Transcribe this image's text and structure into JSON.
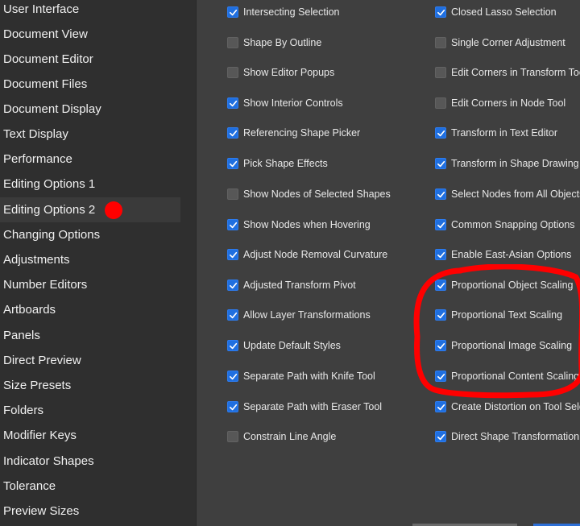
{
  "sidebar": {
    "items": [
      {
        "label": "User Interface"
      },
      {
        "label": "Document View"
      },
      {
        "label": "Document Editor"
      },
      {
        "label": "Document Files"
      },
      {
        "label": "Document Display"
      },
      {
        "label": "Text Display"
      },
      {
        "label": "Performance"
      },
      {
        "label": "Editing Options 1"
      },
      {
        "label": "Editing Options 2",
        "selected": true
      },
      {
        "label": "Changing Options"
      },
      {
        "label": "Adjustments"
      },
      {
        "label": "Number Editors"
      },
      {
        "label": "Artboards"
      },
      {
        "label": "Panels"
      },
      {
        "label": "Direct Preview"
      },
      {
        "label": "Size Presets"
      },
      {
        "label": "Folders"
      },
      {
        "label": "Modifier Keys"
      },
      {
        "label": "Indicator Shapes"
      },
      {
        "label": "Tolerance"
      },
      {
        "label": "Preview Sizes"
      }
    ]
  },
  "options": {
    "left": [
      {
        "label": "Intersecting Selection",
        "checked": true
      },
      {
        "label": "Shape By Outline",
        "checked": false
      },
      {
        "label": "Show Editor Popups",
        "checked": false
      },
      {
        "label": "Show Interior Controls",
        "checked": true
      },
      {
        "label": "Referencing Shape Picker",
        "checked": true
      },
      {
        "label": "Pick Shape Effects",
        "checked": true
      },
      {
        "label": "Show Nodes of Selected Shapes",
        "checked": false
      },
      {
        "label": "Show Nodes when Hovering",
        "checked": true
      },
      {
        "label": "Adjust Node Removal Curvature",
        "checked": true
      },
      {
        "label": "Adjusted Transform Pivot",
        "checked": true
      },
      {
        "label": "Allow Layer Transformations",
        "checked": true
      },
      {
        "label": "Update Default Styles",
        "checked": true
      },
      {
        "label": "Separate Path with Knife Tool",
        "checked": true
      },
      {
        "label": "Separate Path with Eraser Tool",
        "checked": true
      },
      {
        "label": "Constrain Line Angle",
        "checked": false
      }
    ],
    "right": [
      {
        "label": "Closed Lasso Selection",
        "checked": true
      },
      {
        "label": "Single Corner Adjustment",
        "checked": false
      },
      {
        "label": "Edit Corners in Transform Tool",
        "checked": false
      },
      {
        "label": "Edit Corners in Node Tool",
        "checked": false
      },
      {
        "label": "Transform in Text Editor",
        "checked": true
      },
      {
        "label": "Transform in Shape Drawing",
        "checked": true
      },
      {
        "label": "Select Nodes from All Objects",
        "checked": true
      },
      {
        "label": "Common Snapping Options",
        "checked": true
      },
      {
        "label": "Enable East-Asian Options",
        "checked": true
      },
      {
        "label": "Proportional Object Scaling",
        "checked": true
      },
      {
        "label": "Proportional Text Scaling",
        "checked": true
      },
      {
        "label": "Proportional Image Scaling",
        "checked": true
      },
      {
        "label": "Proportional Content Scaling",
        "checked": true
      },
      {
        "label": "Create Distortion on Tool Select",
        "checked": true
      },
      {
        "label": "Direct Shape Transformation",
        "checked": true
      }
    ]
  },
  "colors": {
    "checkbox_on": "#1f6fe0",
    "checkbox_off": "#575757",
    "annotation": "#ff0000"
  }
}
